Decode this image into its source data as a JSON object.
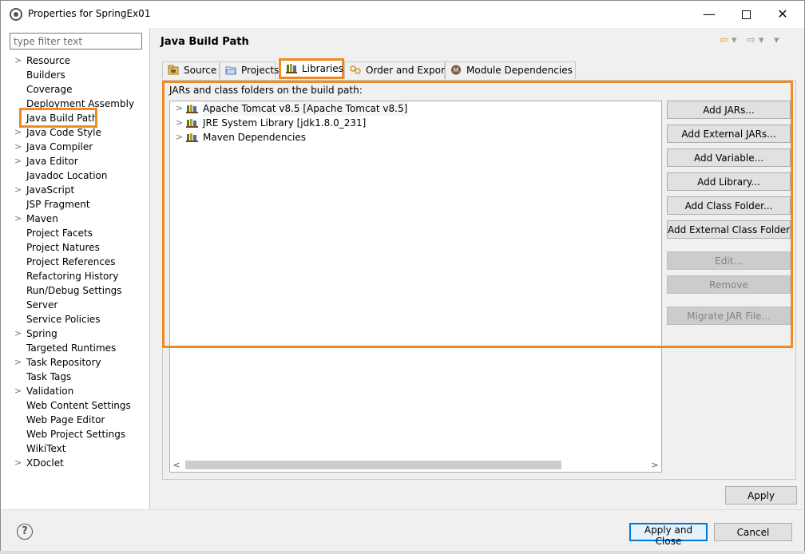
{
  "window": {
    "title": "Properties for SpringEx01",
    "controls": {
      "minimize": "—",
      "close": "✕"
    }
  },
  "sidebar": {
    "filter_placeholder": "type filter text",
    "items": [
      {
        "label": "Resource",
        "expandable": true
      },
      {
        "label": "Builders",
        "expandable": false
      },
      {
        "label": "Coverage",
        "expandable": false
      },
      {
        "label": "Deployment Assembly",
        "expandable": false
      },
      {
        "label": "Java Build Path",
        "expandable": false,
        "selected": true
      },
      {
        "label": "Java Code Style",
        "expandable": true
      },
      {
        "label": "Java Compiler",
        "expandable": true
      },
      {
        "label": "Java Editor",
        "expandable": true
      },
      {
        "label": "Javadoc Location",
        "expandable": false
      },
      {
        "label": "JavaScript",
        "expandable": true
      },
      {
        "label": "JSP Fragment",
        "expandable": false
      },
      {
        "label": "Maven",
        "expandable": true
      },
      {
        "label": "Project Facets",
        "expandable": false
      },
      {
        "label": "Project Natures",
        "expandable": false
      },
      {
        "label": "Project References",
        "expandable": false
      },
      {
        "label": "Refactoring History",
        "expandable": false
      },
      {
        "label": "Run/Debug Settings",
        "expandable": false
      },
      {
        "label": "Server",
        "expandable": false
      },
      {
        "label": "Service Policies",
        "expandable": false
      },
      {
        "label": "Spring",
        "expandable": true
      },
      {
        "label": "Targeted Runtimes",
        "expandable": false
      },
      {
        "label": "Task Repository",
        "expandable": true
      },
      {
        "label": "Task Tags",
        "expandable": false
      },
      {
        "label": "Validation",
        "expandable": true
      },
      {
        "label": "Web Content Settings",
        "expandable": false
      },
      {
        "label": "Web Page Editor",
        "expandable": false
      },
      {
        "label": "Web Project Settings",
        "expandable": false
      },
      {
        "label": "WikiText",
        "expandable": false
      },
      {
        "label": "XDoclet",
        "expandable": true
      }
    ]
  },
  "main": {
    "title": "Java Build Path",
    "tabs": [
      {
        "label": "Source"
      },
      {
        "label": "Projects"
      },
      {
        "label": "Libraries",
        "active": true
      },
      {
        "label": "Order and Export"
      },
      {
        "label": "Module Dependencies"
      }
    ],
    "content_label": "JARs and class folders on the build path:",
    "tree": [
      {
        "label": "Apache Tomcat v8.5 [Apache Tomcat v8.5]"
      },
      {
        "label": "JRE System Library [jdk1.8.0_231]"
      },
      {
        "label": "Maven Dependencies"
      }
    ],
    "buttons": {
      "add_jars": "Add JARs...",
      "add_external_jars": "Add External JARs...",
      "add_variable": "Add Variable...",
      "add_library": "Add Library...",
      "add_class_folder": "Add Class Folder...",
      "add_external_class_folder": "Add External Class Folder...",
      "edit": "Edit...",
      "remove": "Remove",
      "migrate_jar": "Migrate JAR File..."
    },
    "apply": "Apply"
  },
  "footer": {
    "apply_and_close": "Apply and Close",
    "cancel": "Cancel"
  },
  "colors": {
    "highlight": "#f08a24",
    "accent": "#0078d7"
  }
}
